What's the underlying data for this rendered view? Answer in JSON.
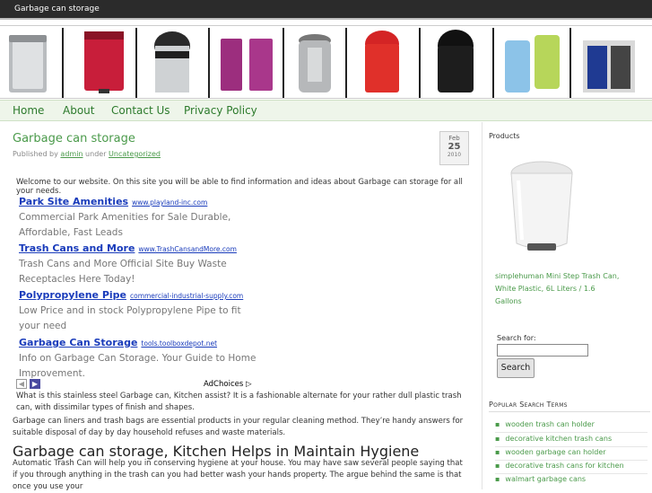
{
  "header": {
    "site_title": "Garbage can storage"
  },
  "banner": {
    "products": [
      "stainless-can",
      "red-pedal-can",
      "swing-top-can",
      "magenta-pedal-cans",
      "chrome-touch-can",
      "red-swing-can",
      "black-bullet-can",
      "pastel-bins",
      "pull-out-bin"
    ]
  },
  "nav": {
    "items": [
      "Home",
      "About",
      "Contact Us",
      "Privacy Policy"
    ]
  },
  "post": {
    "title": "Garbage can storage",
    "meta_prefix": "Published by",
    "author": "admin",
    "meta_mid": "under",
    "category": "Uncategorized",
    "date": {
      "month": "Feb",
      "day": "25",
      "year": "2010"
    },
    "welcome": "Welcome to our website. On this site you will be able to find information and ideas about Garbage can storage for all your needs.",
    "ads": [
      {
        "title": "Park Site Amenities",
        "url": "www.playland-inc.com",
        "desc": "Commercial Park Amenities for Sale Durable, Affordable, Fast Leads"
      },
      {
        "title": "Trash Cans and More",
        "url": "www.TrashCansandMore.com",
        "desc": "Trash Cans and More Official Site Buy Waste Receptacles Here Today!"
      },
      {
        "title": "Polypropylene Pipe",
        "url": "commercial-industrial-supply.com",
        "desc": "Low Price and in stock Polypropylene Pipe to fit your need"
      },
      {
        "title": "Garbage Can Storage",
        "url": "tools.toolboxdepot.net",
        "desc": "Info on Garbage Can Storage. Your Guide to Home Improvement."
      }
    ],
    "adchoices": "AdChoices",
    "para1": "What is this stainless steel Garbage can, Kitchen assist? It is a fashionable alternate for your rather dull plastic trash can, with dissimilar types of finish and shapes.",
    "para2": "Garbage can liners and trash bags are essential products in your regular cleaning method. They’re handy answers for suitable disposal of day by day household refuses and waste materials.",
    "heading": "Garbage can storage, Kitchen Helps in Maintain Hygiene",
    "para3": "Automatic Trash Can will help you in conserving hygiene at your house. You may have saw several people saying that if you through anything in the trash can you had better wash your hands property. The argue behind the same is that once you use your"
  },
  "sidebar": {
    "products_heading": "Products",
    "product_link": "simplehuman Mini Step Trash Can, White Plastic, 6L Liters / 1.6 Gallons",
    "search_label": "Search for:",
    "search_button": "Search",
    "search_value": "",
    "popular_heading": "Popular Search Terms",
    "popular_terms": [
      "wooden trash can holder",
      "decorative kitchen trash cans",
      "wooden garbage can holder",
      "decorative trash cans for kitchen",
      "walmart garbage cans"
    ]
  },
  "colors": {
    "accent": "#4a9a4a",
    "link": "#1a3cbb",
    "topbar": "#2b2b2b",
    "nav_bg": "#eef5ea"
  }
}
